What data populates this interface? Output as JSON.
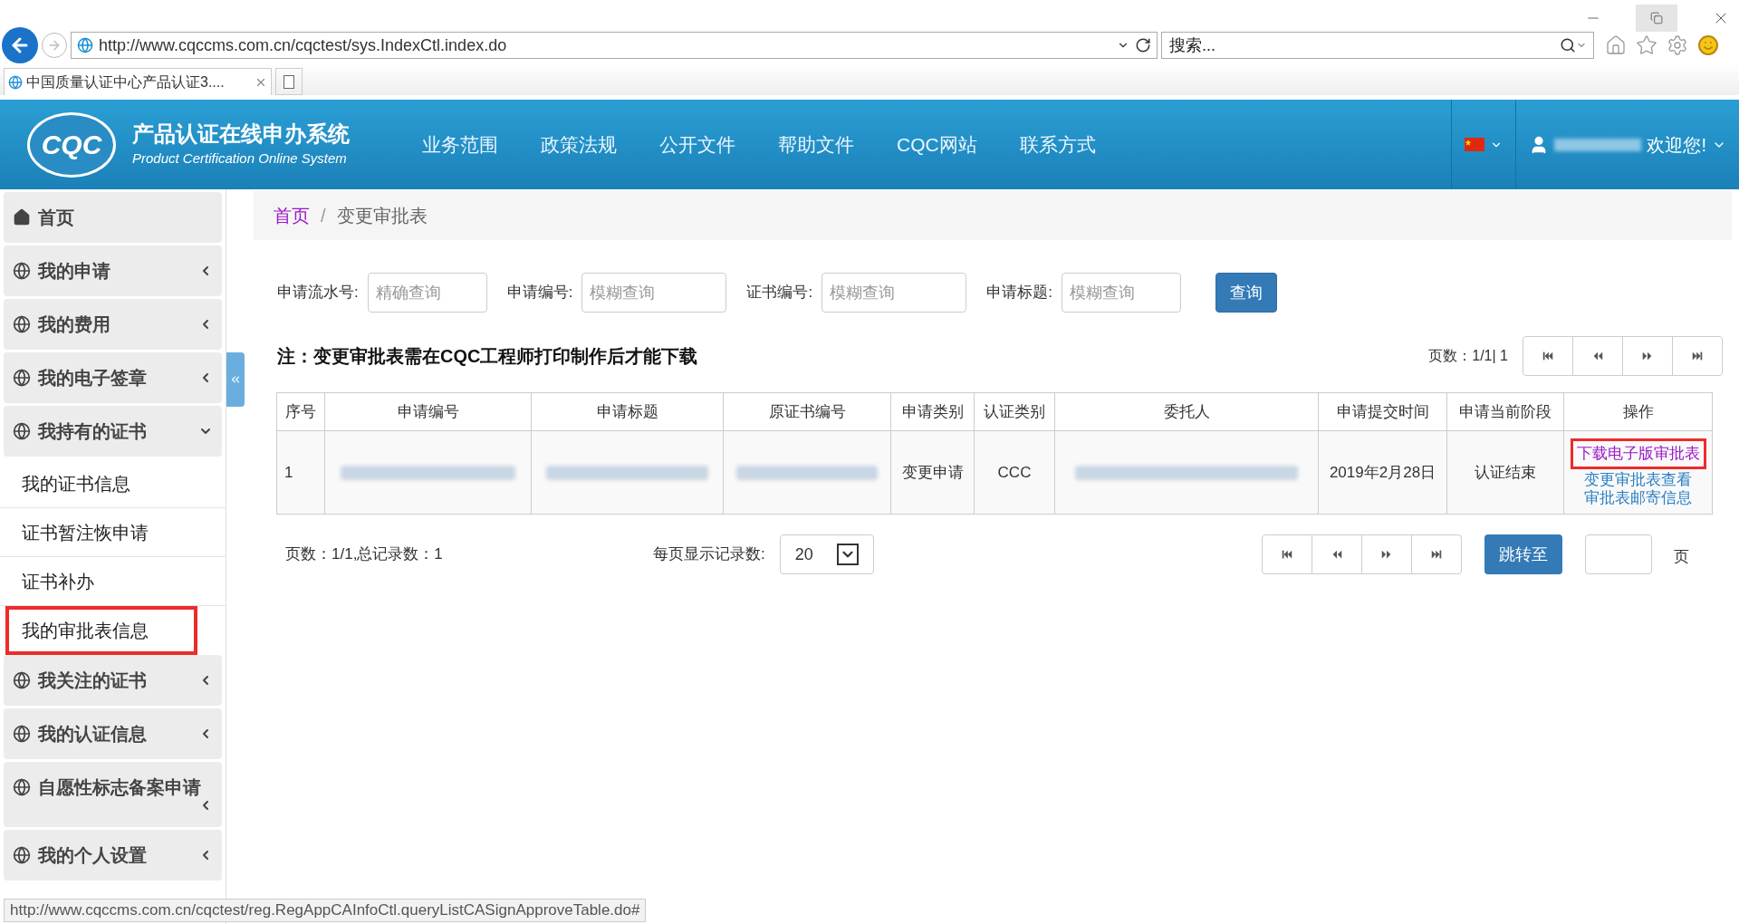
{
  "browser": {
    "url": "http://www.cqccms.com.cn/cqctest/sys.IndexCtl.index.do",
    "search_placeholder": "搜索...",
    "tab_title": "中国质量认证中心产品认证3...."
  },
  "header": {
    "logo_text": "CQC",
    "title": "产品认证在线申办系统",
    "subtitle": "Product Certification Online System",
    "nav": [
      "业务范围",
      "政策法规",
      "公开文件",
      "帮助文件",
      "CQC网站",
      "联系方式"
    ],
    "greeting": "欢迎您!"
  },
  "sidebar": [
    {
      "label": "首页",
      "kind": "home"
    },
    {
      "label": "我的申请",
      "kind": "group",
      "expanded": false
    },
    {
      "label": "我的费用",
      "kind": "group",
      "expanded": false
    },
    {
      "label": "我的电子签章",
      "kind": "group",
      "expanded": false
    },
    {
      "label": "我持有的证书",
      "kind": "group",
      "expanded": true,
      "children": [
        {
          "label": "我的证书信息",
          "selected": false
        },
        {
          "label": "证书暂注恢申请",
          "selected": false
        },
        {
          "label": "证书补办",
          "selected": false
        },
        {
          "label": "我的审批表信息",
          "selected": true
        }
      ]
    },
    {
      "label": "我关注的证书",
      "kind": "group",
      "expanded": false
    },
    {
      "label": "我的认证信息",
      "kind": "group",
      "expanded": false
    },
    {
      "label": "自愿性标志备案申请",
      "kind": "group",
      "expanded": false
    },
    {
      "label": "我的个人设置",
      "kind": "group",
      "expanded": false
    }
  ],
  "breadcrumb": [
    "首页",
    "/",
    "变更审批表"
  ],
  "filters": [
    {
      "label": "申请流水号:",
      "placeholder": "精确查询"
    },
    {
      "label": "申请编号:",
      "placeholder": "模糊查询"
    },
    {
      "label": "证书编号:",
      "placeholder": "模糊查询"
    },
    {
      "label": "申请标题:",
      "placeholder": "模糊查询"
    }
  ],
  "query_button": "查询",
  "note": "注：变更审批表需在CQC工程师打印制作后才能下载",
  "top_page_info": "页数：1/1| 1",
  "table": {
    "columns": [
      "序号",
      "申请编号",
      "申请标题",
      "原证书编号",
      "申请类别",
      "认证类别",
      "委托人",
      "申请提交时间",
      "申请当前阶段",
      "操作"
    ],
    "rows": [
      {
        "cells": [
          {
            "kind": "text",
            "text": "1"
          },
          {
            "kind": "redacted"
          },
          {
            "kind": "redacted"
          },
          {
            "kind": "redacted"
          },
          {
            "kind": "text",
            "text": "变更申请"
          },
          {
            "kind": "text",
            "text": "CCC"
          },
          {
            "kind": "redacted"
          },
          {
            "kind": "text",
            "text": "2019年2月28日"
          },
          {
            "kind": "text",
            "text": "认证结束"
          },
          {
            "kind": "links",
            "links": [
              {
                "text": "下载电子版审批表",
                "highlighted": true
              },
              {
                "text": "变更审批表查看",
                "highlighted": false
              },
              {
                "text": "审批表邮寄信息",
                "highlighted": false
              }
            ]
          }
        ]
      }
    ]
  },
  "footer": {
    "page_info": "页数：1/1,总记录数：1",
    "per_page_label": "每页显示记录数:",
    "per_page": "20",
    "jump_button": "跳转至",
    "page_suffix": "页"
  },
  "status_url": "http://www.cqccms.com.cn/cqctest/reg.RegAppCAInfoCtl.queryListCASignApproveTable.do#"
}
